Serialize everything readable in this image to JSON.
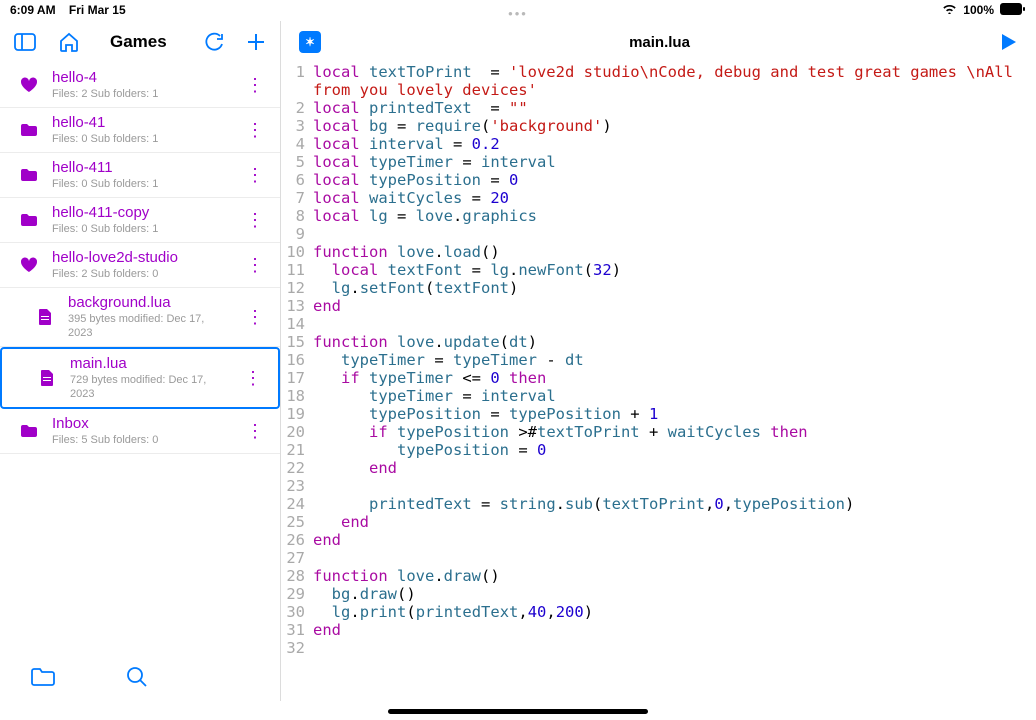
{
  "status": {
    "time": "6:09 AM",
    "date": "Fri Mar 15",
    "battery": "100%"
  },
  "sidebar": {
    "title": "Games",
    "items": [
      {
        "name": "hello-4",
        "meta": "Files: 2 Sub folders: 1",
        "icon": "heart"
      },
      {
        "name": "hello-41",
        "meta": "Files: 0 Sub folders: 1",
        "icon": "folder"
      },
      {
        "name": "hello-411",
        "meta": "Files: 0 Sub folders: 1",
        "icon": "folder"
      },
      {
        "name": "hello-411-copy",
        "meta": "Files: 0 Sub folders: 1",
        "icon": "folder"
      },
      {
        "name": "hello-love2d-studio",
        "meta": "Files: 2 Sub folders: 0",
        "icon": "heart"
      },
      {
        "name": "background.lua",
        "meta": "395 bytes modified: Dec 17, 2023",
        "icon": "file",
        "child": true
      },
      {
        "name": "main.lua",
        "meta": "729 bytes modified: Dec 17, 2023",
        "icon": "file",
        "child": true,
        "selected": true
      },
      {
        "name": "Inbox",
        "meta": "Files: 5 Sub folders: 0",
        "icon": "folder"
      }
    ]
  },
  "editor": {
    "filename": "main.lua",
    "lines": [
      [
        1,
        [
          [
            "kw",
            "local "
          ],
          [
            "id",
            "textToPrint"
          ],
          [
            "op",
            "  = "
          ],
          [
            "str",
            "'love2d studio\\nCode, debug and test great games \\nAll "
          ]
        ]
      ],
      [
        null,
        [
          [
            "str",
            "from you lovely devices'"
          ]
        ]
      ],
      [
        2,
        [
          [
            "kw",
            "local "
          ],
          [
            "id",
            "printedText"
          ],
          [
            "op",
            "  = "
          ],
          [
            "str",
            "\"\""
          ]
        ]
      ],
      [
        3,
        [
          [
            "kw",
            "local "
          ],
          [
            "id",
            "bg"
          ],
          [
            "op",
            " = "
          ],
          [
            "id",
            "require"
          ],
          [
            "op",
            "("
          ],
          [
            "str",
            "'background'"
          ],
          [
            "op",
            ")"
          ]
        ]
      ],
      [
        4,
        [
          [
            "kw",
            "local "
          ],
          [
            "id",
            "interval"
          ],
          [
            "op",
            " = "
          ],
          [
            "num",
            "0.2"
          ]
        ]
      ],
      [
        5,
        [
          [
            "kw",
            "local "
          ],
          [
            "id",
            "typeTimer"
          ],
          [
            "op",
            " = "
          ],
          [
            "id",
            "interval"
          ]
        ]
      ],
      [
        6,
        [
          [
            "kw",
            "local "
          ],
          [
            "id",
            "typePosition"
          ],
          [
            "op",
            " = "
          ],
          [
            "num",
            "0"
          ]
        ]
      ],
      [
        7,
        [
          [
            "kw",
            "local "
          ],
          [
            "id",
            "waitCycles"
          ],
          [
            "op",
            " = "
          ],
          [
            "num",
            "20"
          ]
        ]
      ],
      [
        8,
        [
          [
            "kw",
            "local "
          ],
          [
            "id",
            "lg"
          ],
          [
            "op",
            " = "
          ],
          [
            "id",
            "love"
          ],
          [
            "op",
            "."
          ],
          [
            "id",
            "graphics"
          ]
        ]
      ],
      [
        9,
        []
      ],
      [
        10,
        [
          [
            "kw",
            "function "
          ],
          [
            "id",
            "love"
          ],
          [
            "op",
            "."
          ],
          [
            "id",
            "load"
          ],
          [
            "op",
            "()"
          ]
        ]
      ],
      [
        11,
        [
          [
            "op",
            "  "
          ],
          [
            "kw",
            "local "
          ],
          [
            "id",
            "textFont"
          ],
          [
            "op",
            " = "
          ],
          [
            "id",
            "lg"
          ],
          [
            "op",
            "."
          ],
          [
            "id",
            "newFont"
          ],
          [
            "op",
            "("
          ],
          [
            "num",
            "32"
          ],
          [
            "op",
            ")"
          ]
        ]
      ],
      [
        12,
        [
          [
            "op",
            "  "
          ],
          [
            "id",
            "lg"
          ],
          [
            "op",
            "."
          ],
          [
            "id",
            "setFont"
          ],
          [
            "op",
            "("
          ],
          [
            "id",
            "textFont"
          ],
          [
            "op",
            ")"
          ]
        ]
      ],
      [
        13,
        [
          [
            "kw",
            "end"
          ]
        ]
      ],
      [
        14,
        []
      ],
      [
        15,
        [
          [
            "kw",
            "function "
          ],
          [
            "id",
            "love"
          ],
          [
            "op",
            "."
          ],
          [
            "id",
            "update"
          ],
          [
            "op",
            "("
          ],
          [
            "id",
            "dt"
          ],
          [
            "op",
            ")"
          ]
        ]
      ],
      [
        16,
        [
          [
            "op",
            "   "
          ],
          [
            "id",
            "typeTimer"
          ],
          [
            "op",
            " = "
          ],
          [
            "id",
            "typeTimer"
          ],
          [
            "op",
            " - "
          ],
          [
            "id",
            "dt"
          ]
        ]
      ],
      [
        17,
        [
          [
            "op",
            "   "
          ],
          [
            "kw",
            "if "
          ],
          [
            "id",
            "typeTimer"
          ],
          [
            "op",
            " <= "
          ],
          [
            "num",
            "0"
          ],
          [
            "kw",
            " then"
          ]
        ]
      ],
      [
        18,
        [
          [
            "op",
            "      "
          ],
          [
            "id",
            "typeTimer"
          ],
          [
            "op",
            " = "
          ],
          [
            "id",
            "interval"
          ]
        ]
      ],
      [
        19,
        [
          [
            "op",
            "      "
          ],
          [
            "id",
            "typePosition"
          ],
          [
            "op",
            " = "
          ],
          [
            "id",
            "typePosition"
          ],
          [
            "op",
            " + "
          ],
          [
            "num",
            "1"
          ]
        ]
      ],
      [
        20,
        [
          [
            "op",
            "      "
          ],
          [
            "kw",
            "if "
          ],
          [
            "id",
            "typePosition"
          ],
          [
            "op",
            " >#"
          ],
          [
            "id",
            "textToPrint"
          ],
          [
            "op",
            " + "
          ],
          [
            "id",
            "waitCycles"
          ],
          [
            "kw",
            " then"
          ]
        ]
      ],
      [
        21,
        [
          [
            "op",
            "         "
          ],
          [
            "id",
            "typePosition"
          ],
          [
            "op",
            " = "
          ],
          [
            "num",
            "0"
          ]
        ]
      ],
      [
        22,
        [
          [
            "op",
            "      "
          ],
          [
            "kw",
            "end"
          ]
        ]
      ],
      [
        23,
        []
      ],
      [
        24,
        [
          [
            "op",
            "      "
          ],
          [
            "id",
            "printedText"
          ],
          [
            "op",
            " = "
          ],
          [
            "id",
            "string"
          ],
          [
            "op",
            "."
          ],
          [
            "id",
            "sub"
          ],
          [
            "op",
            "("
          ],
          [
            "id",
            "textToPrint"
          ],
          [
            "op",
            ","
          ],
          [
            "num",
            "0"
          ],
          [
            "op",
            ","
          ],
          [
            "id",
            "typePosition"
          ],
          [
            "op",
            ")"
          ]
        ]
      ],
      [
        25,
        [
          [
            "op",
            "   "
          ],
          [
            "kw",
            "end"
          ]
        ]
      ],
      [
        26,
        [
          [
            "kw",
            "end"
          ]
        ]
      ],
      [
        27,
        []
      ],
      [
        28,
        [
          [
            "kw",
            "function "
          ],
          [
            "id",
            "love"
          ],
          [
            "op",
            "."
          ],
          [
            "id",
            "draw"
          ],
          [
            "op",
            "()"
          ]
        ]
      ],
      [
        29,
        [
          [
            "op",
            "  "
          ],
          [
            "id",
            "bg"
          ],
          [
            "op",
            "."
          ],
          [
            "id",
            "draw"
          ],
          [
            "op",
            "()"
          ]
        ]
      ],
      [
        30,
        [
          [
            "op",
            "  "
          ],
          [
            "id",
            "lg"
          ],
          [
            "op",
            "."
          ],
          [
            "id",
            "print"
          ],
          [
            "op",
            "("
          ],
          [
            "id",
            "printedText"
          ],
          [
            "op",
            ","
          ],
          [
            "num",
            "40"
          ],
          [
            "op",
            ","
          ],
          [
            "num",
            "200"
          ],
          [
            "op",
            ")"
          ]
        ]
      ],
      [
        31,
        [
          [
            "kw",
            "end"
          ]
        ]
      ],
      [
        32,
        []
      ]
    ]
  }
}
